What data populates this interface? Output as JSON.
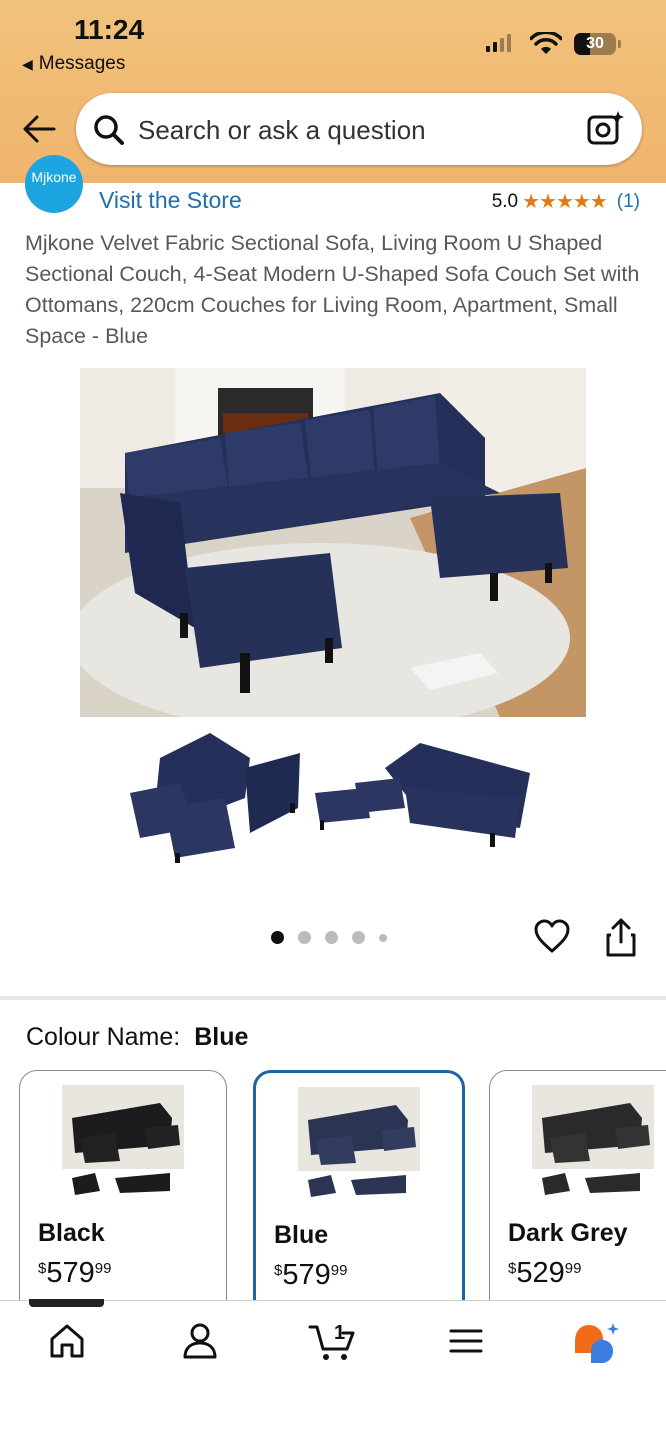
{
  "status_bar": {
    "time": "11:24",
    "back_app": "Messages",
    "battery": "30"
  },
  "search": {
    "placeholder": "Search or ask a question"
  },
  "store": {
    "logo_text": "Mjkone",
    "visit_label": "Visit the Store",
    "rating": "5.0",
    "stars": "★★★★★",
    "review_count": "(1)"
  },
  "product": {
    "title": "Mjkone Velvet Fabric Sectional Sofa, Living Room U Shaped Sectional Couch, 4-Seat Modern U-Shaped Sofa Couch Set with Ottomans, 220cm Couches for Living Room, Apartment, Small Space - Blue"
  },
  "gallery": {
    "image_count": 5,
    "active_index": 0
  },
  "colour": {
    "label": "Colour Name:",
    "selected": "Blue",
    "options": [
      {
        "name": "Black",
        "currency": "$",
        "price_whole": "579",
        "price_fraction": "99",
        "color": "#1c1c1e"
      },
      {
        "name": "Blue",
        "currency": "$",
        "price_whole": "579",
        "price_fraction": "99",
        "color": "#2b3553"
      },
      {
        "name": "Dark Grey",
        "currency": "$",
        "price_whole": "529",
        "price_fraction": "99",
        "color": "#2a2a2c"
      }
    ]
  },
  "tabbar": {
    "items": [
      {
        "name": "home-icon",
        "active": true
      },
      {
        "name": "account-icon"
      },
      {
        "name": "cart-icon",
        "badge": "1"
      },
      {
        "name": "menu-icon"
      },
      {
        "name": "rufus-icon"
      }
    ]
  },
  "colors": {
    "link": "#1f6fa8",
    "star": "#e47911",
    "selected_border": "#2162a1",
    "header": "#f0b46c"
  }
}
